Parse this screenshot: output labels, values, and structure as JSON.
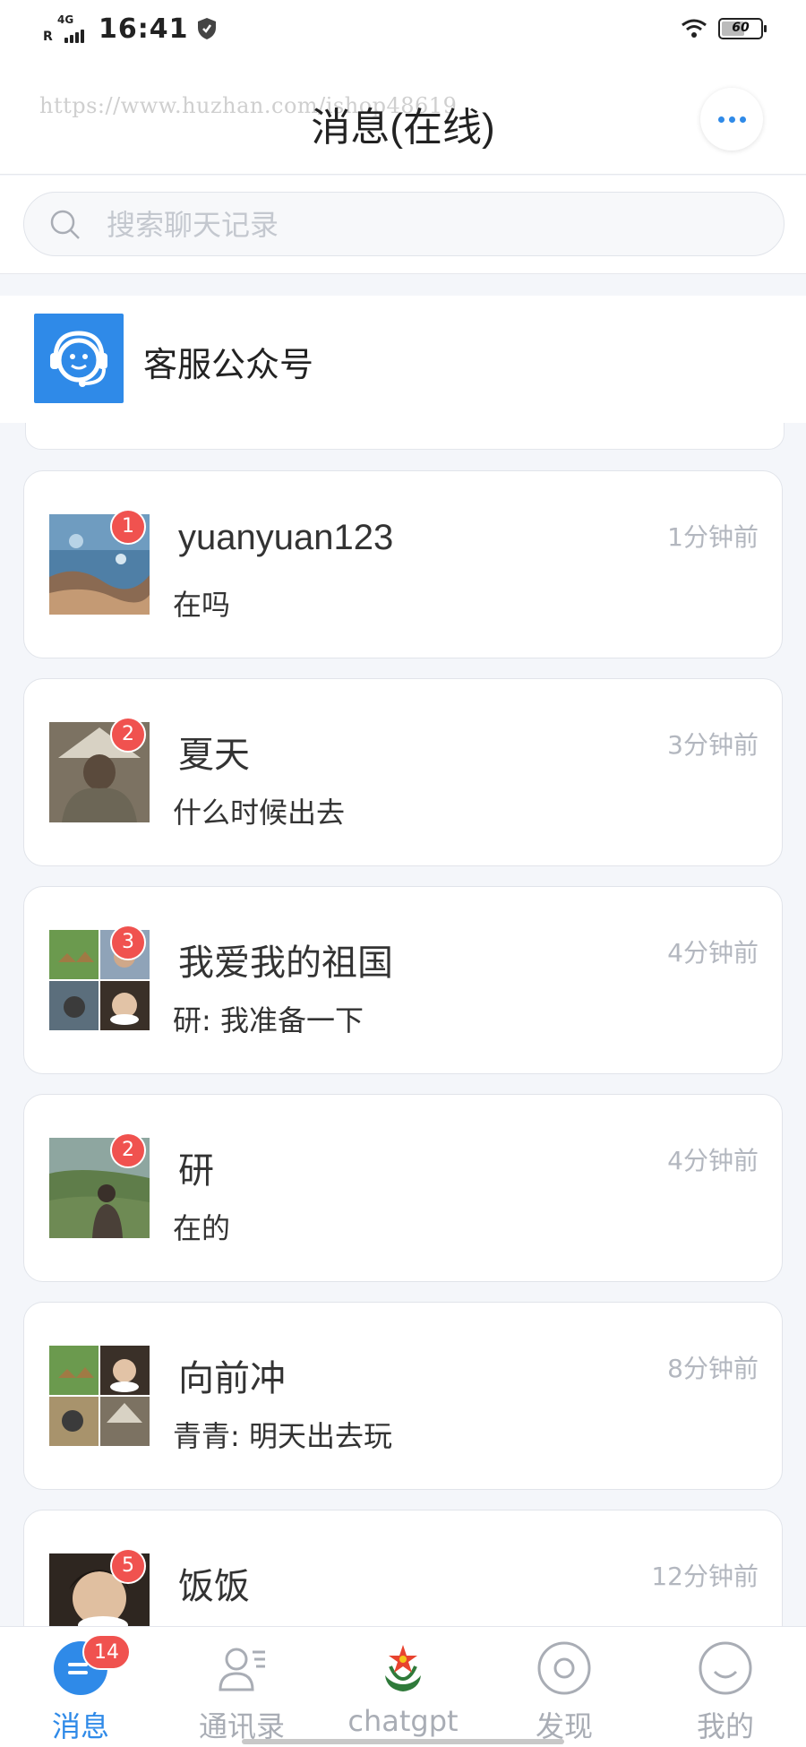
{
  "status_bar": {
    "network_roaming": "R",
    "network_type": "4G",
    "time": "16:41",
    "battery": "60",
    "battery_level": 0.6
  },
  "header": {
    "title": "消息(在线)",
    "watermark": "https://www.huzhan.com/ishop48619",
    "more_icon": "more-dots-icon"
  },
  "search": {
    "placeholder": "搜索聊天记录"
  },
  "service": {
    "label": "客服公众号",
    "icon": "customer-service-headset-icon"
  },
  "chats": [
    {
      "name": "yuanyuan123",
      "message": "在吗",
      "time": "1分钟前",
      "badge": "1"
    },
    {
      "name": "夏天",
      "message": "什么时候出去",
      "time": "3分钟前",
      "badge": "2"
    },
    {
      "name": "我爱我的祖国",
      "message": "研: 我准备一下",
      "time": "4分钟前",
      "badge": "3"
    },
    {
      "name": "研",
      "message": "在的",
      "time": "4分钟前",
      "badge": "2"
    },
    {
      "name": "向前冲",
      "message": "青青: 明天出去玩",
      "time": "8分钟前",
      "badge": ""
    },
    {
      "name": "饭饭",
      "message": "",
      "time": "12分钟前",
      "badge": "5"
    }
  ],
  "bottom_nav": {
    "items": [
      {
        "label": "消息",
        "icon": "message-icon",
        "badge": "14",
        "active": true
      },
      {
        "label": "通讯录",
        "icon": "contacts-icon"
      },
      {
        "label": "chatgpt",
        "icon": "chatgpt-logo-icon"
      },
      {
        "label": "发现",
        "icon": "discover-icon"
      },
      {
        "label": "我的",
        "icon": "profile-icon"
      }
    ]
  },
  "colors": {
    "accent": "#2f8ae8",
    "badge": "#f0524f",
    "inactive": "#a9adb5",
    "background": "#f4f6fa"
  }
}
